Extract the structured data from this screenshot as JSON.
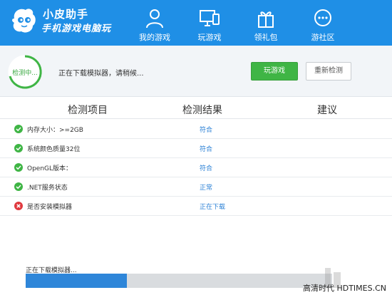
{
  "brand": {
    "title": "小皮助手",
    "subtitle": "手机游戏电脑玩"
  },
  "nav": [
    {
      "label": "我的游戏",
      "icon": "user-icon"
    },
    {
      "label": "玩游戏",
      "icon": "monitor-icon"
    },
    {
      "label": "领礼包",
      "icon": "gift-icon"
    },
    {
      "label": "游社区",
      "icon": "chat-icon"
    }
  ],
  "status": {
    "circle_label": "检测中...",
    "message": "正在下载模拟器，请稍候...",
    "play_button": "玩游戏",
    "recheck_button": "重新检测"
  },
  "table": {
    "headers": [
      "检测项目",
      "检测结果",
      "建议"
    ],
    "rows": [
      {
        "status": "ok",
        "label": "内存大小：>=2GB",
        "result": "符合"
      },
      {
        "status": "ok",
        "label": "系统颜色质量32位",
        "result": "符合"
      },
      {
        "status": "ok",
        "label": "OpenGL版本：",
        "result": "符合"
      },
      {
        "status": "ok",
        "label": ".NET服务状态",
        "result": "正常"
      },
      {
        "status": "error",
        "label": "是否安装模拟器",
        "result": "正在下载"
      }
    ]
  },
  "download": {
    "label": "正在下载模拟器...",
    "progress": 0.33
  },
  "watermark": "高清时代 HDTIMES.CN",
  "colors": {
    "header": "#1f8fe6",
    "ok": "#3fb545",
    "error": "#e0393e",
    "link": "#2d82d6"
  }
}
